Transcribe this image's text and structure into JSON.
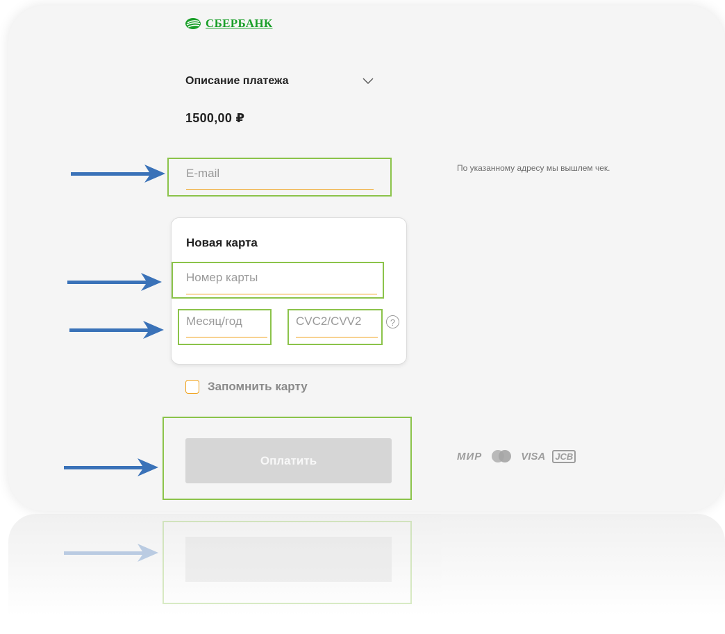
{
  "brand": {
    "name": "СБЕРБАНК",
    "color": "#1a9f29"
  },
  "payment": {
    "description_label": "Описание платежа",
    "amount": "1500,00 ₽"
  },
  "email": {
    "placeholder": "E-mail",
    "hint": "По указанному адресу мы вышлем чек."
  },
  "new_card": {
    "title": "Новая карта",
    "card_number_placeholder": "Номер карты",
    "expiry_placeholder": "Месяц/год",
    "cvc_placeholder": "CVC2/CVV2",
    "help_symbol": "?"
  },
  "remember_card": {
    "label": "Запомнить карту",
    "checked": false
  },
  "pay_button": {
    "label": "Оплатить"
  },
  "payment_systems": {
    "mir": "МИР",
    "visa": "VISA",
    "jcb": "JCB"
  },
  "colors": {
    "accent_line": "#f0a21a",
    "highlight": "#8bc34a",
    "arrow": "#3a72b8"
  }
}
